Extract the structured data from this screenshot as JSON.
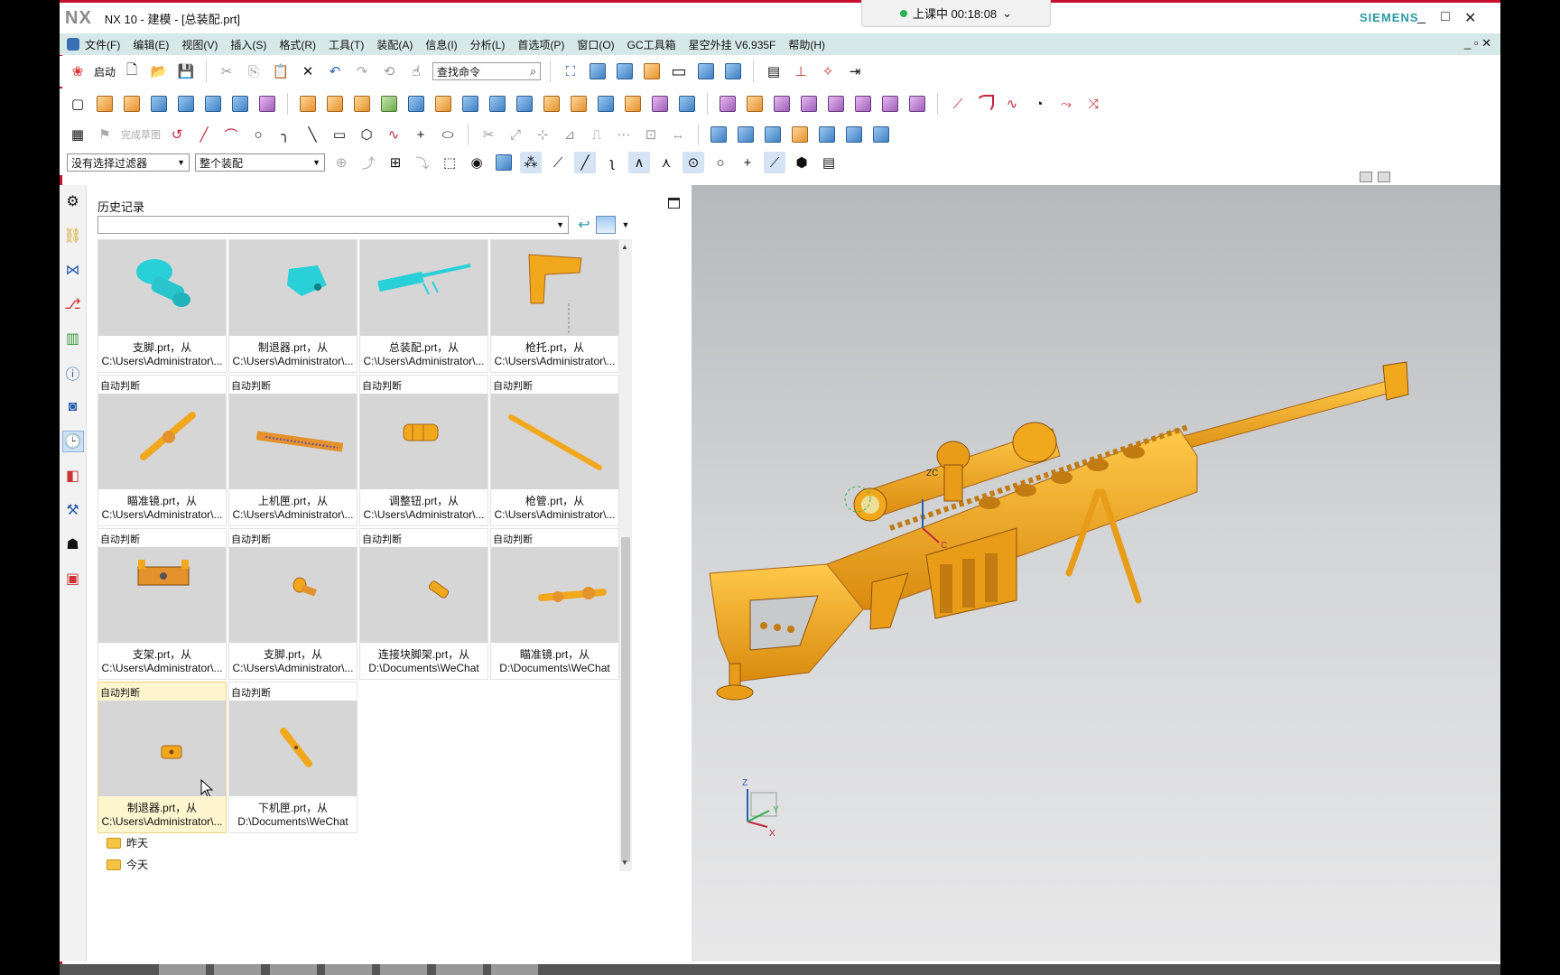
{
  "window": {
    "app_logo": "NX",
    "title": "NX 10 - 建模 - [总装配.prt]",
    "brand": "SIEMENS",
    "session_status": "上课中 00:18:08",
    "controls": [
      "_",
      "□",
      "✕"
    ]
  },
  "menu": {
    "items": [
      "文件(F)",
      "编辑(E)",
      "视图(V)",
      "插入(S)",
      "格式(R)",
      "工具(T)",
      "装配(A)",
      "信息(I)",
      "分析(L)",
      "首选项(P)",
      "窗口(O)",
      "GC工具箱",
      "星空外挂 V6.935F",
      "帮助(H)"
    ],
    "doc_controls": "_ ▫ ✕"
  },
  "toolbar": {
    "start_label": "启动",
    "search_placeholder": "查找命令",
    "sketch_done_label": "完成草图",
    "filter_select": "没有选择过滤器",
    "scope_select": "整个装配"
  },
  "history": {
    "title": "历史记录",
    "rows": [
      [
        {
          "tag": "",
          "name": "支脚.prt，从",
          "path": "C:\\Users\\Administrator\\..."
        },
        {
          "tag": "",
          "name": "制退器.prt，从",
          "path": "C:\\Users\\Administrator\\..."
        },
        {
          "tag": "",
          "name": "总装配.prt，从",
          "path": "C:\\Users\\Administrator\\..."
        },
        {
          "tag": "",
          "name": "枪托.prt，从",
          "path": "C:\\Users\\Administrator\\..."
        }
      ],
      [
        {
          "tag": "自动判断",
          "name": "瞄准镜.prt，从",
          "path": "C:\\Users\\Administrator\\..."
        },
        {
          "tag": "自动判断",
          "name": "上机匣.prt，从",
          "path": "C:\\Users\\Administrator\\..."
        },
        {
          "tag": "自动判断",
          "name": "调整钮.prt，从",
          "path": "C:\\Users\\Administrator\\..."
        },
        {
          "tag": "自动判断",
          "name": "枪管.prt，从",
          "path": "C:\\Users\\Administrator\\..."
        }
      ],
      [
        {
          "tag": "自动判断",
          "name": "支架.prt，从",
          "path": "C:\\Users\\Administrator\\..."
        },
        {
          "tag": "自动判断",
          "name": "支脚.prt，从",
          "path": "C:\\Users\\Administrator\\..."
        },
        {
          "tag": "自动判断",
          "name": "连接块脚架.prt，从",
          "path": "D:\\Documents\\WeChat"
        },
        {
          "tag": "自动判断",
          "name": "瞄准镜.prt，从",
          "path": "D:\\Documents\\WeChat"
        }
      ],
      [
        {
          "tag": "自动判断",
          "name": "制退器.prt，从",
          "path": "C:\\Users\\Administrator\\..."
        },
        {
          "tag": "自动判断",
          "name": "下机匣.prt，从",
          "path": "D:\\Documents\\WeChat"
        }
      ]
    ],
    "folders": [
      "昨天",
      "今天"
    ]
  },
  "viewport": {
    "triad_labels": {
      "x": "X",
      "y": "Y",
      "z": "Z",
      "zc": "ZC",
      "c": "C"
    }
  },
  "colors": {
    "model": "#f2a81d",
    "part_thumb": "#2ad0d8",
    "menubar_bg": "#d7e8e8",
    "brand": "#2a9aa5"
  }
}
